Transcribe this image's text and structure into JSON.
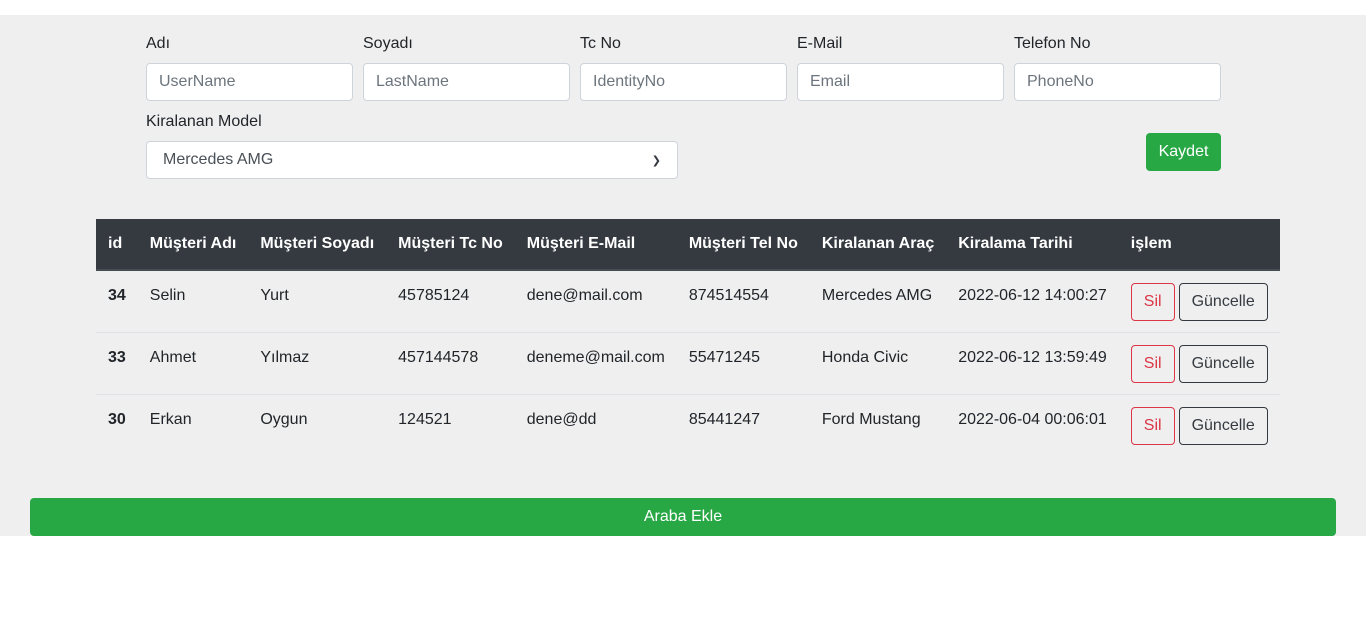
{
  "form": {
    "fields": [
      {
        "label": "Adı",
        "placeholder": "UserName"
      },
      {
        "label": "Soyadı",
        "placeholder": "LastName"
      },
      {
        "label": "Tc No",
        "placeholder": "IdentityNo"
      },
      {
        "label": "E-Mail",
        "placeholder": "Email"
      },
      {
        "label": "Telefon No",
        "placeholder": "PhoneNo"
      }
    ],
    "model_label": "Kiralanan Model",
    "model_selected": "Mercedes AMG",
    "save_label": "Kaydet"
  },
  "table": {
    "headers": [
      "id",
      "Müşteri Adı",
      "Müşteri Soyadı",
      "Müşteri Tc No",
      "Müşteri E-Mail",
      "Müşteri Tel No",
      "Kiralanan Araç",
      "Kiralama Tarihi",
      "işlem"
    ],
    "rows": [
      {
        "id": "34",
        "name": "Selin",
        "surname": "Yurt",
        "tc": "45785124",
        "email": "dene@mail.com",
        "phone": "874514554",
        "car": "Mercedes AMG",
        "date": "2022-06-12 14:00:27"
      },
      {
        "id": "33",
        "name": "Ahmet",
        "surname": "Yılmaz",
        "tc": "457144578",
        "email": "deneme@mail.com",
        "phone": "55471245",
        "car": "Honda Civic",
        "date": "2022-06-12 13:59:49"
      },
      {
        "id": "30",
        "name": "Erkan",
        "surname": "Oygun",
        "tc": "124521",
        "email": "dene@dd",
        "phone": "85441247",
        "car": "Ford Mustang",
        "date": "2022-06-04 00:06:01"
      }
    ],
    "delete_label": "Sil",
    "update_label": "Güncelle"
  },
  "add_car_label": "Araba Ekle",
  "colors": {
    "success": "#28a745",
    "danger": "#dc3545",
    "header_bg": "#343a40",
    "panel_bg": "#efefef"
  }
}
